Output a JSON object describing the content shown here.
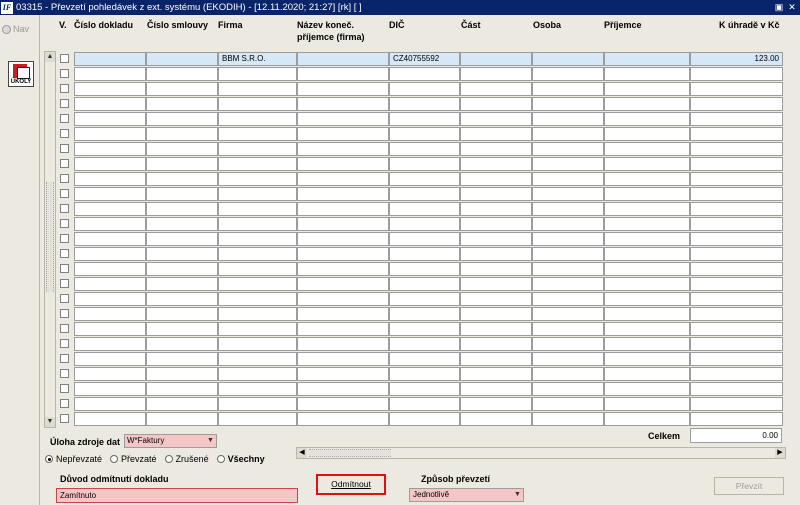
{
  "window": {
    "title": "03315 - Převzetí pohledávek z ext. systému (EKODIH) - [12.11.2020; 21:27]  [rk]  [ ]",
    "logo": "IF",
    "restore_icon": "restore-icon",
    "close_icon": "close-icon"
  },
  "sidebar": {
    "nav_label": "Nav",
    "tasks_label": "ÚKOLY"
  },
  "columns": [
    "V.",
    "Číslo dokladu",
    "Číslo smlouvy",
    "Firma",
    "Název koneč. příjemce (firma)",
    "DIČ",
    "Část",
    "Osoba",
    "Příjemce",
    "K úhradě v Kč"
  ],
  "rows": [
    {
      "selected": true,
      "cislo_dokladu": "",
      "cislo_smlouvy": "",
      "firma": "BBM S.R.O.",
      "nazev": "",
      "dic": "CZ40755592",
      "cast": "",
      "osoba": "",
      "prijemce": "",
      "k_uhrade": "123.00"
    }
  ],
  "empty_rows": 24,
  "footer": {
    "celkem_label": "Celkem",
    "celkem_value": "0.00",
    "uloha_label": "Úloha zdroje dat",
    "uloha_value": "W*Faktury",
    "radios": [
      {
        "label": "Nepřevzaté",
        "checked": true
      },
      {
        "label": "Převzaté",
        "checked": false
      },
      {
        "label": "Zrušené",
        "checked": false
      },
      {
        "label": "Všechny",
        "checked": false
      }
    ],
    "duvod_label": "Důvod odmítnutí dokladu",
    "duvod_value": "Zamítnuto",
    "odmitnout_label": "Odmítnout",
    "zpusob_label": "Způsob převzetí",
    "zpusob_value": "Jednotlivě",
    "prevzit_label": "Převzít"
  },
  "colors": {
    "title_bar": "#0a246a",
    "selected_row": "#d6e7f7",
    "required_field": "#f5c6c6",
    "highlight_border": "#e01010"
  }
}
